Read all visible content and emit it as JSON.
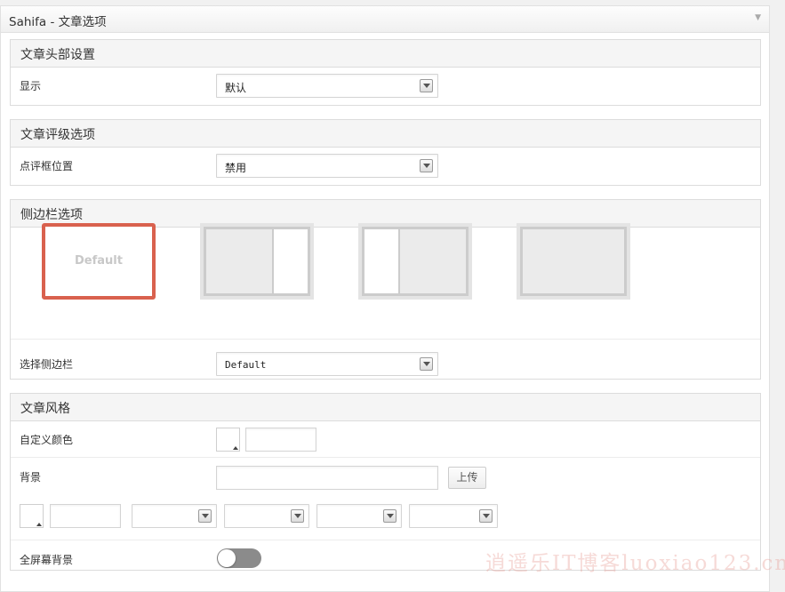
{
  "metabox": {
    "title": "Sahifa - 文章选项",
    "toggle_icon": "triangle-down-icon"
  },
  "post_head": {
    "title": "文章头部设置",
    "display_label": "显示",
    "display_value": "默认"
  },
  "review": {
    "title": "文章评级选项",
    "position_label": "点评框位置",
    "position_value": "禁用"
  },
  "sidebar": {
    "title": "侧边栏选项",
    "layouts": [
      {
        "id": "default",
        "label": "Default",
        "selected": true
      },
      {
        "id": "right-sidebar",
        "selected": false
      },
      {
        "id": "left-sidebar",
        "selected": false
      },
      {
        "id": "no-sidebar",
        "selected": false
      }
    ],
    "choose_label": "选择侧边栏",
    "choose_value": "Default"
  },
  "style": {
    "title": "文章风格",
    "custom_color_label": "自定义颜色",
    "background_label": "背景",
    "upload_label": "上传",
    "fullscreen_label": "全屏幕背景",
    "fullscreen_on": false
  },
  "watermark": "逍遥乐IT博客luoxiao123.cn",
  "colors": {
    "selected_border": "#d9614e",
    "toggle_off": "#8b8b8b"
  }
}
